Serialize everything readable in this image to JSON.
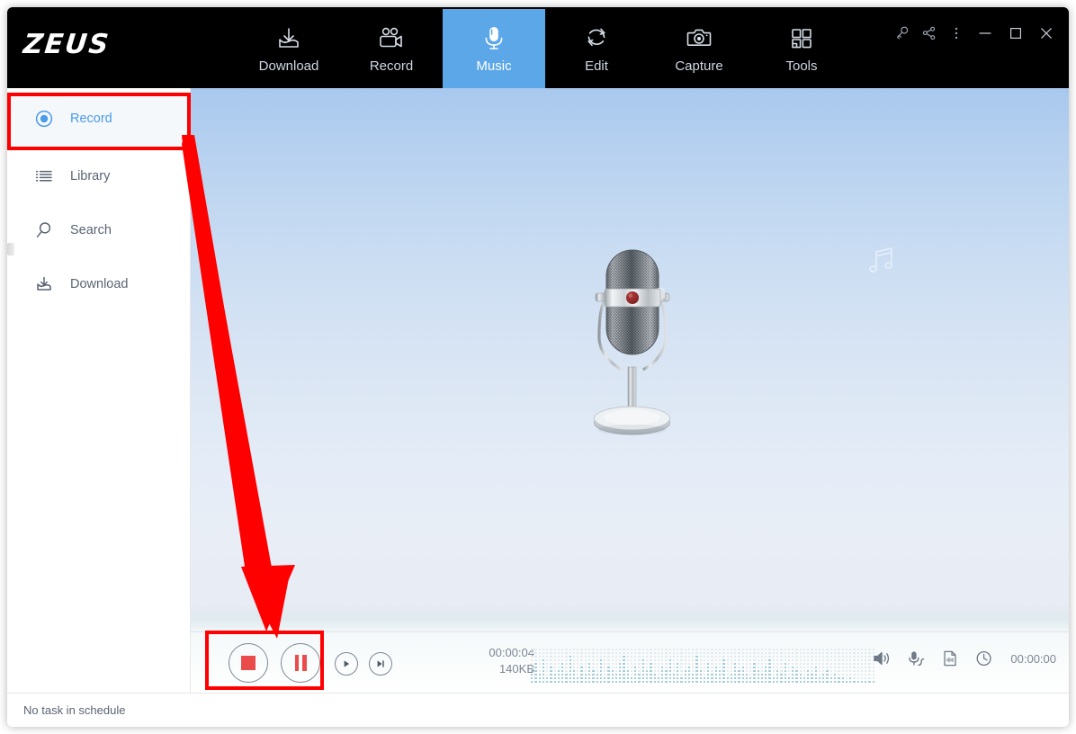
{
  "app": {
    "logo": "ZEUS",
    "status_text": "No task in schedule"
  },
  "topnav": {
    "tabs": [
      {
        "label": "Download",
        "icon": "download-icon",
        "active": false
      },
      {
        "label": "Record",
        "icon": "video-camera-icon",
        "active": false
      },
      {
        "label": "Music",
        "icon": "microphone-icon",
        "active": true
      },
      {
        "label": "Edit",
        "icon": "refresh-circle-icon",
        "active": false
      },
      {
        "label": "Capture",
        "icon": "camera-icon",
        "active": false
      },
      {
        "label": "Tools",
        "icon": "grid-squares-icon",
        "active": false
      }
    ],
    "active_accent": "#5BA7E8",
    "window_buttons": [
      {
        "name": "key-icon",
        "glyph": "key"
      },
      {
        "name": "share-icon",
        "glyph": "share"
      },
      {
        "name": "more-menu-icon",
        "glyph": "dots"
      },
      {
        "name": "minimize-icon",
        "glyph": "minimize"
      },
      {
        "name": "maximize-icon",
        "glyph": "maximize"
      },
      {
        "name": "close-icon",
        "glyph": "close"
      }
    ]
  },
  "sidebar": {
    "items": [
      {
        "label": "Record",
        "icon": "radio-record-icon",
        "active": true
      },
      {
        "label": "Library",
        "icon": "list-icon",
        "active": false
      },
      {
        "label": "Search",
        "icon": "magnifier-icon",
        "active": false
      },
      {
        "label": "Download",
        "icon": "download-icon",
        "active": false
      }
    ],
    "active_color": "#4A9BE8"
  },
  "stage": {
    "artwork": "retro-microphone",
    "watermark": "music-note-icon"
  },
  "controls": {
    "stop_label": "Stop",
    "pause_label": "Pause",
    "play_label": "Play",
    "next_label": "Next",
    "elapsed": "00:00:04",
    "filesize": "140KB",
    "schedule_time": "00:00:00",
    "record_color": "#ea4b4b",
    "right_icons": [
      {
        "name": "speaker-icon"
      },
      {
        "name": "microphone-input-icon"
      },
      {
        "name": "audio-file-icon"
      },
      {
        "name": "clock-icon"
      }
    ],
    "spectrum": {
      "label": "audio-spectrum",
      "bars": [
        4,
        6,
        3,
        7,
        2,
        5,
        3,
        4,
        6,
        3,
        8,
        4,
        2,
        5,
        3,
        6,
        4,
        3,
        7,
        2,
        5,
        4,
        3,
        6,
        8,
        4,
        2,
        5,
        3,
        7,
        4,
        6,
        3,
        2,
        5,
        4,
        7,
        3,
        6,
        2,
        4,
        5,
        3,
        8,
        4,
        2,
        6,
        3,
        5,
        4,
        7,
        2,
        3,
        6,
        4,
        5,
        3,
        2,
        6,
        4,
        3,
        5,
        7,
        2,
        4,
        3,
        6,
        2,
        5,
        4,
        3,
        2,
        4,
        3,
        5,
        2,
        3,
        4,
        2,
        3,
        2,
        2,
        1,
        2,
        1,
        1,
        1,
        1,
        1,
        1
      ],
      "rows": 10
    }
  },
  "annotations": {
    "highlight_color": "#ff0000",
    "boxes": [
      "sidebar-record-item",
      "stop-and-pause-buttons"
    ],
    "arrow": "arrow-pointing-to-stop-pause-buttons"
  }
}
